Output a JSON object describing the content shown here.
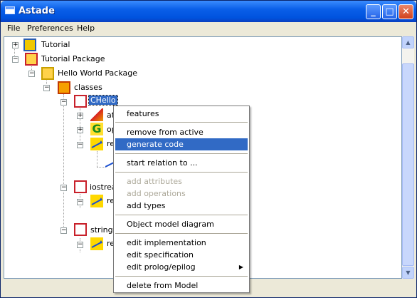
{
  "window": {
    "title": "Astade"
  },
  "menubar": [
    "File",
    "Preferences",
    "Help"
  ],
  "tree": {
    "tutorial": "Tutorial",
    "tutorial_package": "Tutorial Package",
    "hello_world_package": "Hello World Package",
    "classes": "classes",
    "chello": "CHello",
    "at_partial": "at",
    "op_partial": "op",
    "re_partial": "re",
    "iostream_partial": "iostrea",
    "string": "string"
  },
  "context_menu": {
    "items": [
      {
        "label": "features",
        "enabled": true
      },
      {
        "label": "remove from active component",
        "enabled": true
      },
      {
        "label": "generate code",
        "enabled": true,
        "highlighted": true
      },
      {
        "label": "start relation to ...",
        "enabled": true
      },
      {
        "label": "add attributes",
        "enabled": false
      },
      {
        "label": "add operations",
        "enabled": false
      },
      {
        "label": "add types",
        "enabled": true
      },
      {
        "label": "Object model diagram",
        "enabled": true
      },
      {
        "label": "edit implementation",
        "enabled": true
      },
      {
        "label": "edit specification",
        "enabled": true
      },
      {
        "label": "edit prolog/epilog",
        "enabled": true,
        "submenu": true
      },
      {
        "label": "delete from Model",
        "enabled": true
      }
    ]
  },
  "colors": {
    "titlebar": "#0053de",
    "selection": "#316ac5",
    "disabled": "#aca899"
  }
}
